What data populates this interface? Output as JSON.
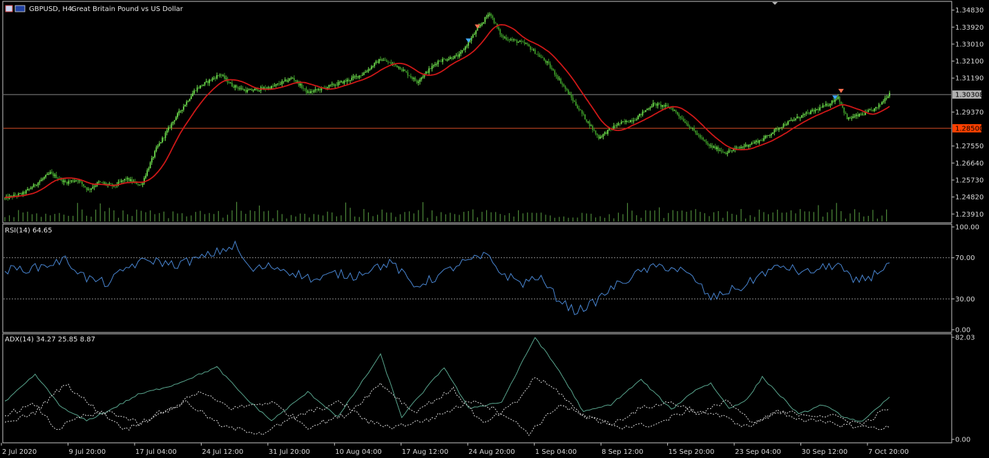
{
  "header": {
    "symbol_label": "GBPUSD, H4:",
    "description": "Great Britain Pound vs US Dollar"
  },
  "colors": {
    "background": "#000000",
    "frame": "#c8c8c8",
    "candle_bull": "#6fe04e",
    "candle_bear": "#3c9a28",
    "volume": "#4e8a3a",
    "ma_line": "#d01818",
    "rsi_line": "#4a88d6",
    "adx_main": "#5aa890",
    "adx_di": "#e0e0e0",
    "bid_line": "#8a8a8a",
    "level_line": "#e05028",
    "level_tag": "#ff4000",
    "bid_tag": "#b0b0b0"
  },
  "chart_data": [
    {
      "type": "candlestick",
      "ylim": [
        1.2355,
        1.3515
      ],
      "yticks": [
        "1.34830",
        "1.33920",
        "1.33010",
        "1.32100",
        "1.31190",
        "1.29370",
        "1.27550",
        "1.26640",
        "1.25730",
        "1.24820",
        "1.23910"
      ],
      "ytick_values": [
        1.3483,
        1.3392,
        1.3301,
        1.321,
        1.3119,
        1.2937,
        1.2755,
        1.2664,
        1.2573,
        1.2482,
        1.2391
      ],
      "xticks": [
        "2 Jul 2020",
        "9 Jul 20:00",
        "17 Jul 04:00",
        "24 Jul 12:00",
        "31 Jul 20:00",
        "10 Aug 04:00",
        "17 Aug 12:00",
        "24 Aug 20:00",
        "1 Sep 04:00",
        "8 Sep 12:00",
        "15 Sep 20:00",
        "23 Sep 04:00",
        "30 Sep 12:00",
        "7 Oct 20:00"
      ],
      "bid_price": "1.30308",
      "bid_value": 1.30308,
      "level_price": "1.28500",
      "level_value": 1.285,
      "moving_average": "red line (period not shown)",
      "volume": "histogram",
      "path": [
        [
          0,
          1.2475
        ],
        [
          12,
          1.25
        ],
        [
          20,
          1.2548
        ],
        [
          30,
          1.261
        ],
        [
          40,
          1.256
        ],
        [
          48,
          1.2575
        ],
        [
          55,
          1.252
        ],
        [
          62,
          1.256
        ],
        [
          72,
          1.254
        ],
        [
          80,
          1.258
        ],
        [
          90,
          1.2545
        ],
        [
          100,
          1.274
        ],
        [
          112,
          1.29
        ],
        [
          126,
          1.306
        ],
        [
          142,
          1.314
        ],
        [
          150,
          1.308
        ],
        [
          160,
          1.305
        ],
        [
          176,
          1.307
        ],
        [
          190,
          1.312
        ],
        [
          200,
          1.304
        ],
        [
          212,
          1.307
        ],
        [
          224,
          1.31
        ],
        [
          236,
          1.314
        ],
        [
          248,
          1.322
        ],
        [
          260,
          1.318
        ],
        [
          272,
          1.31
        ],
        [
          286,
          1.321
        ],
        [
          300,
          1.324
        ],
        [
          312,
          1.338
        ],
        [
          320,
          1.347
        ],
        [
          328,
          1.334
        ],
        [
          344,
          1.33
        ],
        [
          358,
          1.32
        ],
        [
          366,
          1.311
        ],
        [
          380,
          1.294
        ],
        [
          392,
          1.28
        ],
        [
          404,
          1.287
        ],
        [
          416,
          1.29
        ],
        [
          428,
          1.298
        ],
        [
          440,
          1.296
        ],
        [
          452,
          1.286
        ],
        [
          464,
          1.276
        ],
        [
          476,
          1.272
        ],
        [
          488,
          1.2755
        ],
        [
          500,
          1.279
        ],
        [
          512,
          1.286
        ],
        [
          524,
          1.291
        ],
        [
          536,
          1.295
        ],
        [
          544,
          1.298
        ],
        [
          550,
          1.302
        ],
        [
          556,
          1.29
        ],
        [
          566,
          1.2925
        ],
        [
          576,
          1.296
        ],
        [
          584,
          1.304
        ]
      ],
      "total_bars": 585
    },
    {
      "type": "line",
      "title": "RSI(14) 64.65",
      "ylim": [
        0,
        100
      ],
      "yticks": [
        "100.00",
        "70.00",
        "30.00",
        "0.00"
      ],
      "ytick_values": [
        100,
        70,
        30,
        0
      ],
      "levels": [
        70,
        30
      ],
      "path": [
        [
          0,
          58
        ],
        [
          20,
          60
        ],
        [
          40,
          68
        ],
        [
          54,
          50
        ],
        [
          68,
          45
        ],
        [
          82,
          62
        ],
        [
          96,
          68
        ],
        [
          112,
          63
        ],
        [
          130,
          70
        ],
        [
          152,
          82
        ],
        [
          162,
          58
        ],
        [
          176,
          62
        ],
        [
          190,
          56
        ],
        [
          206,
          48
        ],
        [
          218,
          55
        ],
        [
          230,
          52
        ],
        [
          242,
          60
        ],
        [
          256,
          65
        ],
        [
          270,
          42
        ],
        [
          286,
          52
        ],
        [
          300,
          64
        ],
        [
          318,
          72
        ],
        [
          328,
          55
        ],
        [
          342,
          45
        ],
        [
          352,
          52
        ],
        [
          364,
          32
        ],
        [
          376,
          18
        ],
        [
          388,
          25
        ],
        [
          400,
          40
        ],
        [
          412,
          50
        ],
        [
          422,
          58
        ],
        [
          434,
          62
        ],
        [
          446,
          58
        ],
        [
          456,
          48
        ],
        [
          466,
          30
        ],
        [
          478,
          38
        ],
        [
          488,
          42
        ],
        [
          500,
          55
        ],
        [
          514,
          62
        ],
        [
          528,
          55
        ],
        [
          540,
          60
        ],
        [
          550,
          64
        ],
        [
          560,
          46
        ],
        [
          572,
          52
        ],
        [
          584,
          65
        ]
      ]
    },
    {
      "type": "line",
      "title": "ADX(14) 34.27 25.85 8.87",
      "ylim": [
        0,
        82.03
      ],
      "yticks": [
        "82.03",
        "0.00"
      ],
      "ytick_values": [
        82.03,
        0
      ],
      "series": [
        {
          "role": "adx",
          "path": [
            [
              0,
              30
            ],
            [
              20,
              52
            ],
            [
              38,
              25
            ],
            [
              54,
              15
            ],
            [
              70,
              24
            ],
            [
              88,
              36
            ],
            [
              112,
              44
            ],
            [
              140,
              58
            ],
            [
              160,
              32
            ],
            [
              176,
              15
            ],
            [
              200,
              38
            ],
            [
              220,
              18
            ],
            [
              248,
              68
            ],
            [
              262,
              18
            ],
            [
              290,
              58
            ],
            [
              306,
              25
            ],
            [
              328,
              30
            ],
            [
              350,
              82
            ],
            [
              366,
              55
            ],
            [
              382,
              22
            ],
            [
              400,
              28
            ],
            [
              420,
              48
            ],
            [
              440,
              24
            ],
            [
              456,
              40
            ],
            [
              466,
              45
            ],
            [
              478,
              25
            ],
            [
              490,
              32
            ],
            [
              500,
              50
            ],
            [
              512,
              35
            ],
            [
              524,
              20
            ],
            [
              540,
              28
            ],
            [
              554,
              18
            ],
            [
              566,
              14
            ],
            [
              584,
              34
            ]
          ]
        },
        {
          "role": "+di",
          "path": [
            [
              0,
              20
            ],
            [
              20,
              28
            ],
            [
              34,
              8
            ],
            [
              50,
              18
            ],
            [
              70,
              22
            ],
            [
              90,
              12
            ],
            [
              110,
              25
            ],
            [
              128,
              38
            ],
            [
              150,
              25
            ],
            [
              176,
              30
            ],
            [
              200,
              10
            ],
            [
              226,
              20
            ],
            [
              248,
              45
            ],
            [
              270,
              22
            ],
            [
              296,
              40
            ],
            [
              316,
              12
            ],
            [
              338,
              30
            ],
            [
              350,
              50
            ],
            [
              366,
              38
            ],
            [
              380,
              20
            ],
            [
              400,
              12
            ],
            [
              420,
              25
            ],
            [
              440,
              30
            ],
            [
              460,
              20
            ],
            [
              476,
              32
            ],
            [
              494,
              12
            ],
            [
              510,
              22
            ],
            [
              530,
              20
            ],
            [
              550,
              18
            ],
            [
              566,
              12
            ],
            [
              584,
              26
            ]
          ]
        },
        {
          "role": "-di",
          "path": [
            [
              0,
              12
            ],
            [
              20,
              22
            ],
            [
              40,
              45
            ],
            [
              56,
              28
            ],
            [
              80,
              8
            ],
            [
              100,
              20
            ],
            [
              120,
              30
            ],
            [
              144,
              10
            ],
            [
              170,
              5
            ],
            [
              196,
              20
            ],
            [
              222,
              30
            ],
            [
              240,
              14
            ],
            [
              256,
              10
            ],
            [
              280,
              16
            ],
            [
              310,
              32
            ],
            [
              330,
              20
            ],
            [
              346,
              5
            ],
            [
              366,
              28
            ],
            [
              384,
              18
            ],
            [
              406,
              10
            ],
            [
              430,
              12
            ],
            [
              452,
              24
            ],
            [
              470,
              20
            ],
            [
              490,
              10
            ],
            [
              510,
              22
            ],
            [
              530,
              15
            ],
            [
              550,
              12
            ],
            [
              566,
              10
            ],
            [
              584,
              9
            ]
          ]
        }
      ]
    }
  ]
}
